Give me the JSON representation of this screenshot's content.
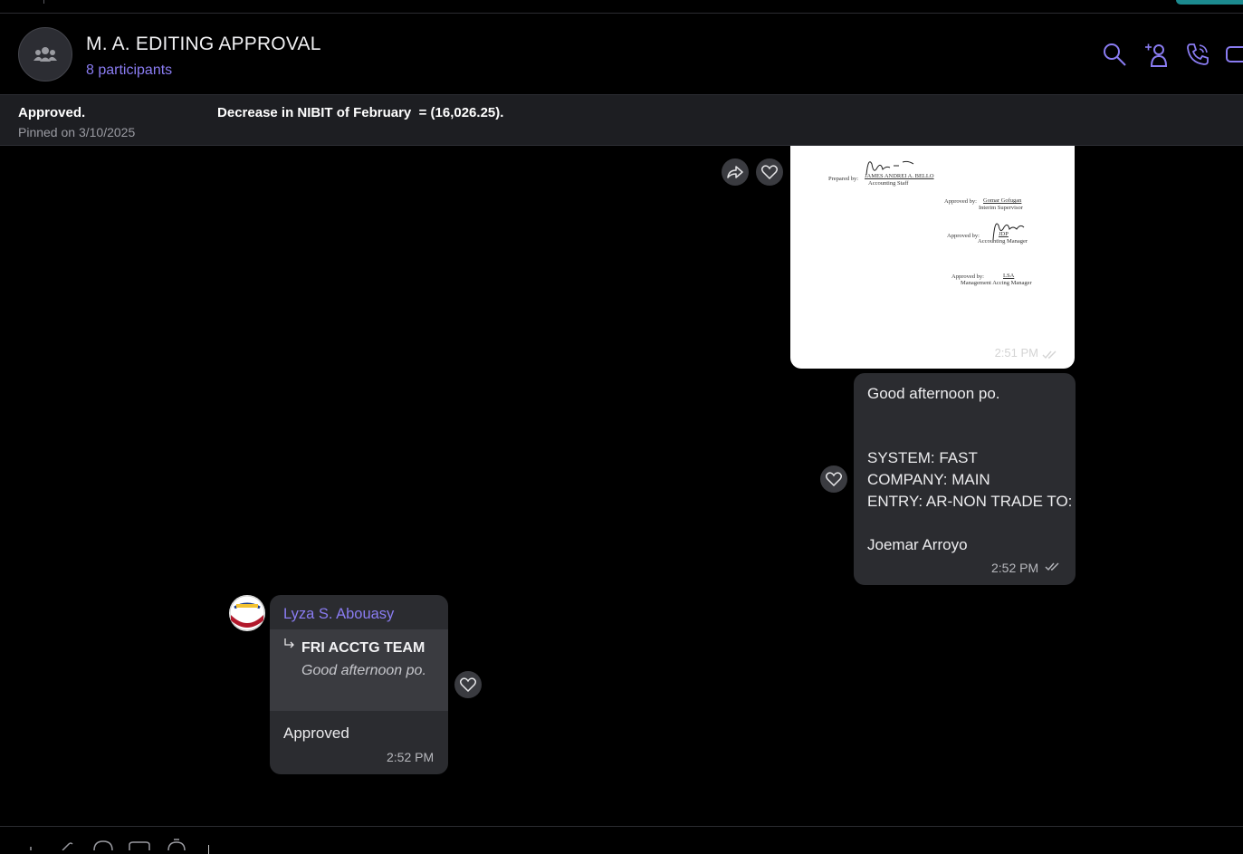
{
  "conversation": {
    "title": "M. A. EDITING APPROVAL",
    "participants": "8 participants"
  },
  "header_icons": [
    "search-icon",
    "add-person-icon",
    "phone-icon",
    "video-icon"
  ],
  "pinned": {
    "text": "Approved.                                   Decrease in NIBIT of February  = (16,026.25).",
    "date": "Pinned on 3/10/2025"
  },
  "messages": {
    "image_message": {
      "time": "2:51 PM",
      "document_lines": {
        "prepared_by": "Prepared by:",
        "prepared_name": "JAMES ANDREI A. BELLO",
        "prepared_role": "Accounting Staff",
        "approved1": "Approved by:",
        "approved1_name": "Gomar Gofugan",
        "approved1_role": "Interim Supervisor",
        "approved2": "Approved by:",
        "approved2_name": "JDP",
        "approved2_role": "Accounting Manager",
        "approved3": "Approved by:",
        "approved3_name": "LSA",
        "approved3_role": "Management Acctng Manager"
      }
    },
    "outgoing_text": {
      "line1": "Good afternoon po.",
      "line2": "SYSTEM: FAST",
      "line3": "COMPANY: MAIN",
      "line4": "ENTRY: AR-NON TRADE TO:",
      "line5": "Joemar Arroyo",
      "time": "2:52 PM"
    },
    "incoming_reply": {
      "sender": "Lyza S. Abouasy",
      "quoted_from": "FRI ACCTG TEAM",
      "quoted_text": "Good afternoon po.",
      "text": "Approved",
      "time": "2:52 PM"
    }
  },
  "colors": {
    "accent": "#8a7cf2",
    "bubble": "#2b2c30",
    "background": "#000000"
  }
}
